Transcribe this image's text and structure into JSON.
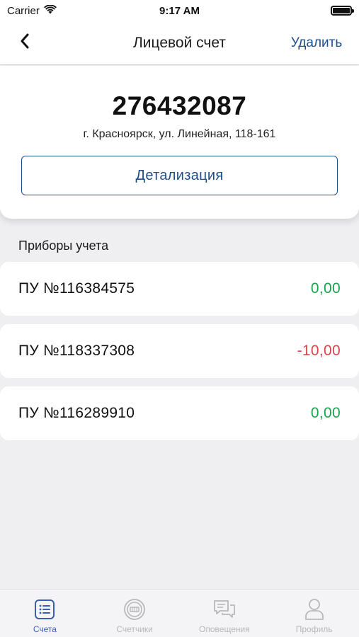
{
  "status_bar": {
    "carrier": "Carrier",
    "time": "9:17 AM"
  },
  "nav": {
    "title": "Лицевой счет",
    "delete_label": "Удалить"
  },
  "account": {
    "number": "276432087",
    "address": "г. Красноярск, ул. Линейная, 118-161",
    "detail_button": "Детализация"
  },
  "meters": {
    "section_title": "Приборы учета",
    "items": [
      {
        "name": "ПУ №116384575",
        "value": "0,00",
        "color": "#1aa34a"
      },
      {
        "name": "ПУ №118337308",
        "value": "-10,00",
        "color": "#d6454d"
      },
      {
        "name": "ПУ №116289910",
        "value": "0,00",
        "color": "#1aa34a"
      }
    ]
  },
  "tabs": [
    {
      "label": "Счета",
      "icon": "list-icon",
      "active": true
    },
    {
      "label": "Счетчики",
      "icon": "meter-icon",
      "active": false
    },
    {
      "label": "Оповещения",
      "icon": "chat-bubbles-icon",
      "active": false
    },
    {
      "label": "Профиль",
      "icon": "person-icon",
      "active": false
    }
  ],
  "colors": {
    "accent": "#1f4e8c",
    "tab_active": "#3a5fb0",
    "tab_inactive": "#b7b7bc",
    "positive": "#1aa34a",
    "negative": "#d6454d"
  }
}
